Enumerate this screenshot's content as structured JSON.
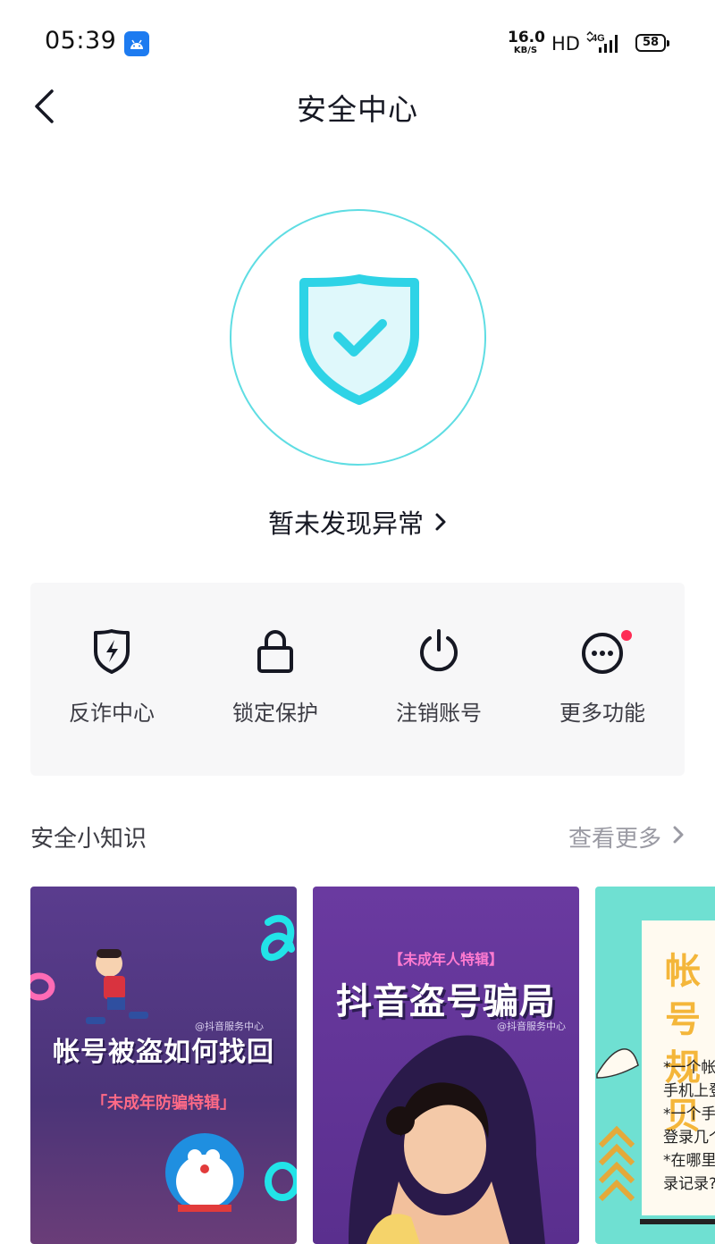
{
  "status_bar": {
    "time": "05:39",
    "net_speed_value": "16.0",
    "net_speed_unit": "KB/S",
    "hd": "HD",
    "network": "4G",
    "battery": "58"
  },
  "header": {
    "title": "安全中心",
    "back_icon": "chevron-left-icon"
  },
  "security_status": {
    "icon": "shield-check-icon",
    "text": "暂未发现异常",
    "ring_color": "#5fdde3",
    "shield_color": "#2ed3e6"
  },
  "features": [
    {
      "label": "反诈中心",
      "icon": "shield-bolt-icon"
    },
    {
      "label": "锁定保护",
      "icon": "lock-icon"
    },
    {
      "label": "注销账号",
      "icon": "power-icon"
    },
    {
      "label": "更多功能",
      "icon": "more-icon",
      "badge": true
    }
  ],
  "tips": {
    "title": "安全小知识",
    "more_label": "查看更多",
    "cards": [
      {
        "title": "帐号被盗如何找回",
        "subtitle": "「未成年防骗特辑」",
        "credit": "@抖音服务中心"
      },
      {
        "tag": "【未成年人特辑】",
        "title": "抖音盗号骗局",
        "credit": "@抖音服务中心"
      },
      {
        "title_line1": "帐号",
        "title_line2": "规贝",
        "lines": [
          "*一个帐",
          "手机上登",
          "*一个手",
          "登录几个",
          "*在哪里",
          "录记录?"
        ]
      }
    ]
  },
  "colors": {
    "accent": "#2ed3e6",
    "badge": "#fe2c55",
    "panel_bg": "#f7f7f8"
  }
}
